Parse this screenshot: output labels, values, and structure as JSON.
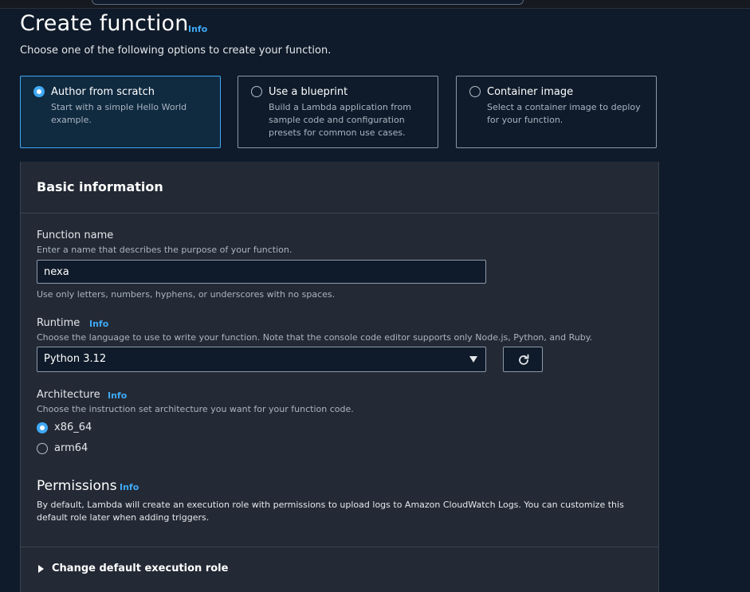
{
  "header": {
    "title": "Create function",
    "info": "Info",
    "subtitle": "Choose one of the following options to create your function."
  },
  "options": [
    {
      "title": "Author from scratch",
      "desc": "Start with a simple Hello World example.",
      "selected": true
    },
    {
      "title": "Use a blueprint",
      "desc": "Build a Lambda application from sample code and configuration presets for common use cases.",
      "selected": false
    },
    {
      "title": "Container image",
      "desc": "Select a container image to deploy for your function.",
      "selected": false
    }
  ],
  "basic": {
    "title": "Basic information",
    "function_name": {
      "label": "Function name",
      "desc": "Enter a name that describes the purpose of your function.",
      "value": "nexa",
      "hint": "Use only letters, numbers, hyphens, or underscores with no spaces."
    },
    "runtime": {
      "label": "Runtime",
      "info": "Info",
      "desc": "Choose the language to use to write your function. Note that the console code editor supports only Node.js, Python, and Ruby.",
      "value": "Python 3.12"
    },
    "architecture": {
      "label": "Architecture",
      "info": "Info",
      "desc": "Choose the instruction set architecture you want for your function code.",
      "options": [
        "x86_64",
        "arm64"
      ],
      "selected": "x86_64"
    },
    "permissions": {
      "title": "Permissions",
      "info": "Info",
      "desc": "By default, Lambda will create an execution role with permissions to upload logs to Amazon CloudWatch Logs. You can customize this default role later when adding triggers.",
      "expander": "Change default execution role"
    }
  },
  "icons": {
    "refresh": "refresh-icon",
    "dropdown": "caret-down-icon",
    "expander": "caret-right-icon"
  },
  "colors": {
    "accent": "#3fa9f5",
    "background": "#0f1b2a",
    "panel": "#232a35"
  }
}
